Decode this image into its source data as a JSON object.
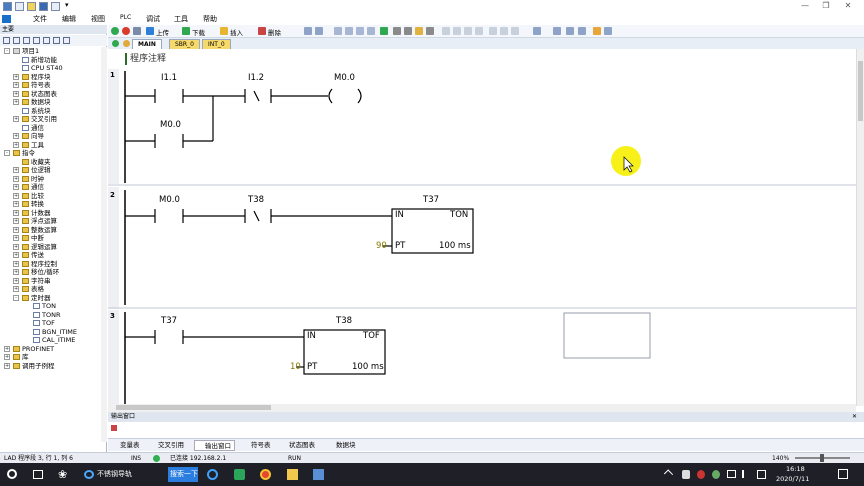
{
  "window": {
    "quick_access_extra": "▾",
    "controls": [
      "—",
      "❐",
      "✕"
    ]
  },
  "menu": [
    "文件",
    "编辑",
    "视图",
    "PLC",
    "调试",
    "工具",
    "帮助"
  ],
  "project_pane": {
    "header": "主要",
    "tree": [
      {
        "label": "项目1",
        "level": 0,
        "icon": "project",
        "exp": "-"
      },
      {
        "label": "新增功能",
        "level": 1,
        "icon": "doc",
        "exp": ""
      },
      {
        "label": "CPU ST40",
        "level": 1,
        "icon": "cpu",
        "exp": ""
      },
      {
        "label": "程序块",
        "level": 1,
        "icon": "folder",
        "exp": "+"
      },
      {
        "label": "符号表",
        "level": 1,
        "icon": "folder",
        "exp": "+"
      },
      {
        "label": "状态图表",
        "level": 1,
        "icon": "folder",
        "exp": "+"
      },
      {
        "label": "数据块",
        "level": 1,
        "icon": "folder",
        "exp": "+"
      },
      {
        "label": "系统块",
        "level": 1,
        "icon": "doc",
        "exp": ""
      },
      {
        "label": "交叉引用",
        "level": 1,
        "icon": "folder",
        "exp": "+"
      },
      {
        "label": "通信",
        "level": 1,
        "icon": "doc",
        "exp": ""
      },
      {
        "label": "向导",
        "level": 1,
        "icon": "folder",
        "exp": "+"
      },
      {
        "label": "工具",
        "level": 1,
        "icon": "folder",
        "exp": "+"
      },
      {
        "label": "指令",
        "level": 0,
        "icon": "folder",
        "exp": "-"
      },
      {
        "label": "收藏夹",
        "level": 1,
        "icon": "folder",
        "exp": ""
      },
      {
        "label": "位逻辑",
        "level": 1,
        "icon": "folder",
        "exp": "+"
      },
      {
        "label": "时钟",
        "level": 1,
        "icon": "folder",
        "exp": "+"
      },
      {
        "label": "通信",
        "level": 1,
        "icon": "folder",
        "exp": "+"
      },
      {
        "label": "比较",
        "level": 1,
        "icon": "folder",
        "exp": "+"
      },
      {
        "label": "转换",
        "level": 1,
        "icon": "folder",
        "exp": "+"
      },
      {
        "label": "计数器",
        "level": 1,
        "icon": "folder",
        "exp": "+"
      },
      {
        "label": "浮点运算",
        "level": 1,
        "icon": "folder",
        "exp": "+"
      },
      {
        "label": "整数运算",
        "level": 1,
        "icon": "folder",
        "exp": "+"
      },
      {
        "label": "中断",
        "level": 1,
        "icon": "folder",
        "exp": "+"
      },
      {
        "label": "逻辑运算",
        "level": 1,
        "icon": "folder",
        "exp": "+"
      },
      {
        "label": "传送",
        "level": 1,
        "icon": "folder",
        "exp": "+"
      },
      {
        "label": "程序控制",
        "level": 1,
        "icon": "folder",
        "exp": "+"
      },
      {
        "label": "移位/循环",
        "level": 1,
        "icon": "folder",
        "exp": "+"
      },
      {
        "label": "字符串",
        "level": 1,
        "icon": "folder",
        "exp": "+"
      },
      {
        "label": "表格",
        "level": 1,
        "icon": "folder",
        "exp": "+"
      },
      {
        "label": "定时器",
        "level": 1,
        "icon": "folder",
        "exp": "-"
      },
      {
        "label": "TON",
        "level": 2,
        "icon": "doc",
        "exp": ""
      },
      {
        "label": "TONR",
        "level": 2,
        "icon": "doc",
        "exp": ""
      },
      {
        "label": "TOF",
        "level": 2,
        "icon": "doc",
        "exp": ""
      },
      {
        "label": "BGN_ITIME",
        "level": 2,
        "icon": "doc",
        "exp": ""
      },
      {
        "label": "CAL_ITIME",
        "level": 2,
        "icon": "doc",
        "exp": ""
      },
      {
        "label": "PROFINET",
        "level": 0,
        "icon": "folder",
        "exp": "+"
      },
      {
        "label": "库",
        "level": 0,
        "icon": "folder",
        "exp": "+"
      },
      {
        "label": "调用子例程",
        "level": 0,
        "icon": "folder",
        "exp": "+"
      }
    ]
  },
  "toolbar": {
    "upload_label": "上传",
    "download_label": "下载",
    "insert_label": "插入",
    "delete_label": "删除"
  },
  "tabs": [
    "MAIN",
    "SBR_0",
    "INT_0"
  ],
  "editor": {
    "program_comment": "程序注释",
    "networks": [
      {
        "number": "1",
        "contacts": [
          "I1.1",
          "I1.2",
          "M0.0"
        ],
        "coil": "M0.0",
        "parallel_contact": "M0.0"
      },
      {
        "number": "2",
        "contacts": [
          "M0.0",
          "T38"
        ],
        "box_title": "T37",
        "box_type": "TON",
        "in_label": "IN",
        "pt_label": "PT",
        "pt_value": "90",
        "time_base": "100 ms"
      },
      {
        "number": "3",
        "contacts": [
          "T37"
        ],
        "box_title": "T38",
        "box_type": "TOF",
        "in_label": "IN",
        "pt_label": "PT",
        "pt_value": "10",
        "time_base": "100 ms"
      }
    ]
  },
  "output_window": {
    "title": "输出窗口",
    "close": "✕"
  },
  "bottom_tabs": [
    "变量表",
    "交叉引用",
    "输出窗口",
    "符号表",
    "状态图表",
    "数据块"
  ],
  "status": {
    "position": "LAD 程序段 3, 行 1, 列 6",
    "mode": "INS",
    "connection": "已连接 192.168.2.1",
    "run_state": "RUN",
    "zoom": "140%"
  },
  "taskbar": {
    "window_title": "不锈钢导轨",
    "search_label": "搜索一下",
    "time": "16:18",
    "date": "2020/7/11"
  }
}
